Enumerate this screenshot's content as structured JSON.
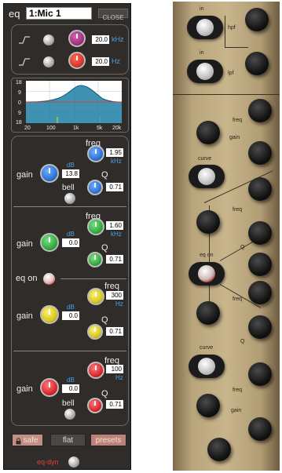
{
  "panel": {
    "label": "eq",
    "channel": "1:Mic 1",
    "close_label": "CLOSE"
  },
  "filters": {
    "hpf": {
      "value": "20.0",
      "unit": "kHz",
      "knob_color": "#9b2f7a"
    },
    "lpf": {
      "value": "20.0",
      "unit": "Hz",
      "knob_color": "#d63324"
    }
  },
  "graph": {
    "y_ticks": [
      "18",
      "9",
      "0",
      "9",
      "18"
    ],
    "x_ticks": [
      "20",
      "100",
      "1k",
      "5k",
      "20k"
    ]
  },
  "bands": [
    {
      "gain_label": "gain",
      "db_unit": "dB",
      "gain_value": "13.8",
      "freq_label": "freq",
      "freq_value": "1.95",
      "freq_unit": "kHz",
      "q_label": "Q",
      "q_value": "0.71",
      "curve_label": "bell",
      "color": "#2c6fd4"
    },
    {
      "gain_label": "gain",
      "db_unit": "dB",
      "gain_value": "0.0",
      "freq_label": "freq",
      "freq_value": "1.60",
      "freq_unit": "kHz",
      "q_label": "Q",
      "q_value": "0.71",
      "color": "#2ea83a"
    },
    {
      "gain_label": "gain",
      "db_unit": "dB",
      "gain_value": "0.0",
      "freq_label": "freq",
      "freq_value": "300",
      "freq_unit": "Hz",
      "q_label": "Q",
      "q_value": "0.71",
      "color": "#d6c419"
    },
    {
      "gain_label": "gain",
      "db_unit": "dB",
      "gain_value": "0.0",
      "freq_label": "freq",
      "freq_value": "100",
      "freq_unit": "Hz",
      "q_label": "Q",
      "q_value": "0.71",
      "curve_label": "bell",
      "color": "#d6242a"
    }
  ],
  "eq_on_label": "eq on",
  "footer": {
    "safe_label": "safe",
    "flat_label": "flat",
    "presets_label": "presets",
    "eq_dyn_label": "eq-dyn"
  },
  "hardware": {
    "labels": {
      "in_1": "in",
      "hpf": "hpf",
      "in_2": "in",
      "lpf": "lpf",
      "freq_1": "freq",
      "gain_1": "gain",
      "curve_1": "curve",
      "freq_2": "freq",
      "q_1": "Q",
      "eq_on": "eq on",
      "freq_3": "freq",
      "q_2": "Q",
      "curve_2": "curve",
      "freq_4": "freq",
      "gain_2": "gain"
    }
  },
  "colors": {
    "panel_bg": "#2f2c2a",
    "accent_blue": "#4aa3e8",
    "button_pink": "#b9837b"
  }
}
